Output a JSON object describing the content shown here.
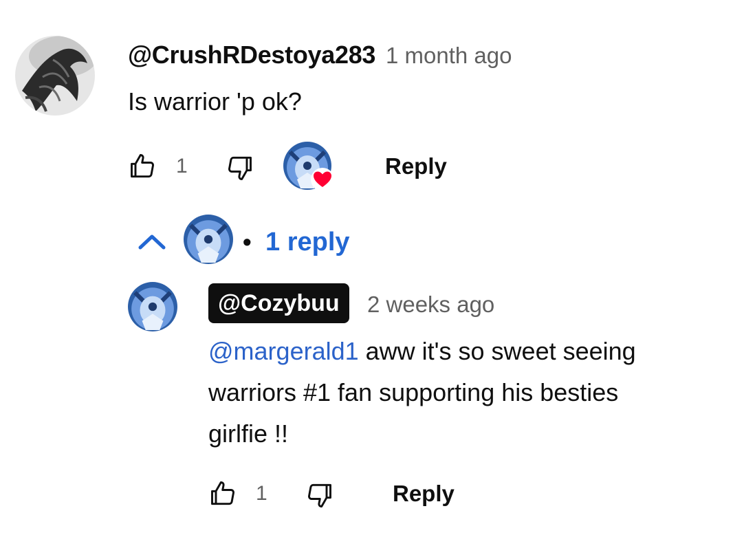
{
  "top_comment": {
    "author": "@CrushRDestoya283",
    "time": "1 month ago",
    "text": "Is warrior 'p ok?",
    "like_count": "1",
    "reply_label": "Reply"
  },
  "replies_toggle": {
    "label": "1 reply",
    "separator": "•"
  },
  "reply_comment": {
    "author": "@Cozybuu",
    "time": "2 weeks ago",
    "mention": "@margerald1",
    "text_line1": " aww it's so sweet seeing",
    "text_line2": "warriors #1 fan supporting his besties",
    "text_line3": "girlfie !!",
    "like_count": "1",
    "reply_label": "Reply"
  },
  "colors": {
    "accent_blue": "#2267d3",
    "heart_red": "#ff0033",
    "muted_gray": "#606060"
  },
  "icons": [
    "thumbs-up-icon",
    "thumbs-down-icon",
    "creator-heart-icon",
    "chevron-up-icon"
  ]
}
